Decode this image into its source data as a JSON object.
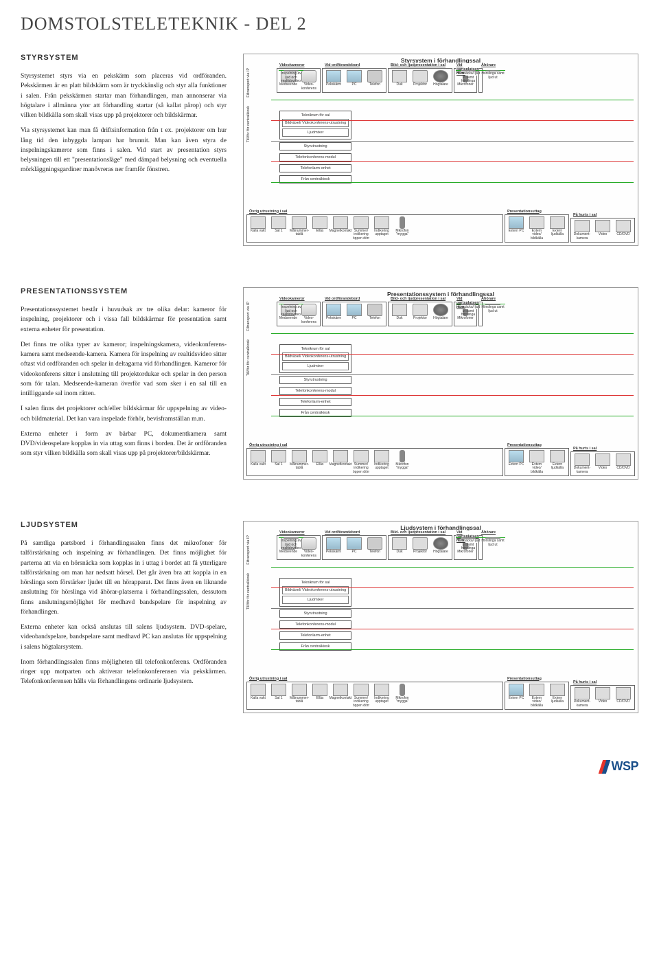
{
  "page": {
    "title_main": "DOMSTOLSTELETEKNIK",
    "title_sub": " - DEL 2"
  },
  "logo": {
    "text": "WSP"
  },
  "sections": {
    "styrsystem": {
      "heading": "STYRSYSTEM",
      "paragraphs": [
        "Styrsystemet styrs via en pekskärm som placeras vid ordföranden. Pekskärmen är en platt bildskärm som är tryckkänslig och styr alla funktioner i salen. Från pekskärmen startar man förhandlingen, man annonserar via högtalare i allmänna ytor att förhandling startar (så kallat pårop) och styr vilken bildkälla som skall visas upp på projektorer och bildskärmar.",
        "Via styrsystemet kan man få driftsinformation från t ex. projektorer om hur lång tid den inbyggda lampan har brunnit. Man kan även styra de inspelningskameror som finns i salen. Vid start av presentation styrs belysningen till ett \"presentationsläge\" med dämpad belysning och eventuella mörkläggningsgardiner manövreras ner framför fönstren."
      ],
      "diagram_title": "Styrsystem i förhandlingssal"
    },
    "presentation": {
      "heading": "PRESENTATIONSSYSTEM",
      "paragraphs": [
        "Presentationssystemet består i huvudsak av tre olika delar: kameror för inspelning, projektorer och i vissa fall bildskärmar för presentation samt externa enheter för presentation.",
        "Det finns tre olika typer av kameror; inspelningskamera, videokonferens-kamera samt medseende-kamera. Kamera för inspelning av realtidsvideo sitter oftast vid ordföranden och spelar in deltagarna vid förhandlingen. Kameror för videokonferens sitter i anslutning till projektordukar och spelar in den person som för talan. Medseende-kameran överför vad som sker i en sal till en intilliggande sal inom rätten.",
        "I salen finns det projektorer och/eller bildskärmar för uppspelning av video- och bildmaterial. Det kan vara inspelade förhör, bevisframställan m.m.",
        "Externa enheter i form av bärbar PC, dokumentkamera samt DVD/videospelare kopplas in via uttag som finns i borden. Det är ordföranden som styr vilken bildkälla som skall visas upp på projektorer/bildskärmar."
      ],
      "diagram_title": "Presentationssystem i förhandlingssal"
    },
    "ljud": {
      "heading": "LJUDSYSTEM",
      "paragraphs": [
        "På samtliga partsbord i förhandlingssalen finns det mikrofoner för talförstärkning och inspelning av förhandlingen. Det finns möjlighet för parterna att via en hörsnäcka som kopplas in i uttag i bordet att få ytterligare talförstärkning om man har nedsatt hörsel. Det går även bra att koppla in en hörslinga som förstärker ljudet till en hörapparat. Det finns även en liknande anslutning för hörslinga vid åhörar-platserna i förhandlingssalen, dessutom finns anslutningsmöjlighet för medhavd bandspelare för inspelning av förhandlingen.",
        "Externa enheter kan också anslutas till salens ljudsystem. DVD-spelare, videobandspelare, bandspelare samt medhavd PC kan anslutas för uppspelning i salens högtalarsystem.",
        "Inom förhandlingssalen finns möjligheten till telefonkonferens. Ordföranden ringer upp motparten och aktiverar telefonkonferensen via pekskärmen. Telefonkonferensen hålls via förhandlingens ordinarie ljudsystem."
      ],
      "diagram_title": "Ljudsystem i förhandlingssal"
    }
  },
  "diagram": {
    "groups": {
      "videokameror": {
        "label": "Videokameror",
        "items": [
          "Medseende",
          "Inspelning av ljud och realtidsvideo",
          "Video-konferens"
        ]
      },
      "ordforande": {
        "label": "Vid ordförandebord",
        "items": [
          "Pekskärm",
          "PC",
          "Telefon"
        ]
      },
      "bildljud": {
        "label": "Bild- och ljudpresentation i sal",
        "items": [
          "Duk",
          "Projektor",
          "Högtalare"
        ]
      },
      "partsplatser": {
        "label": "Vid partsplatser m.m.",
        "items": [
          "Hörsnäcka/ ljud ut samt hörslinga",
          "Mikrofoner"
        ]
      },
      "ahorare": {
        "label": "Åhörare",
        "items": [
          "Hörslinga samt ljud ut"
        ]
      },
      "ovrigt": {
        "label": "Övrig utrustning i sal",
        "items": [
          "Kalla vakt",
          "Sal 1",
          "Målnummer-tablå",
          "Ellås",
          "Magnetkontakt",
          "Summer/ indikering öppen dörr",
          "Indikering upptaget",
          "Mikrofon \"mygga\""
        ]
      },
      "presuttag": {
        "label": "Presentationsuttag",
        "items": [
          "Extern PC",
          "Extern video/ bildkälla",
          "Extern ljudkälla"
        ]
      },
      "hurts": {
        "label": "På hurts i sal",
        "items": [
          "Dokument-kamera",
          "Video",
          "CD/DVD"
        ]
      }
    },
    "side": {
      "vlabel1": "Filtransport via IP",
      "vlabel2": "Till/för för centralkiosk",
      "teknikrum": "Teknikrum för sal",
      "bildvaxel": "Bildväxel/ Videokonferens-utrustning",
      "ljudmixer": "Ljudmixer",
      "styr": "Styrutrustning",
      "telekonf": "Telefonkonferens-modul",
      "telelarm": "Telefonlarm-enhet",
      "centralkiosk": "Från centralkiosk"
    }
  }
}
